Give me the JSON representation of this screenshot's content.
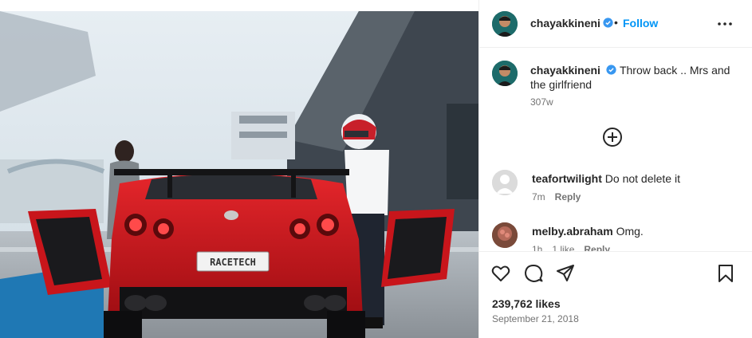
{
  "post": {
    "image_alt": "",
    "colors": {
      "accent": "#0095f6",
      "verified": "#3897f0",
      "car_red": "#d11a1f"
    },
    "plate_text": "RACETECH"
  },
  "header": {
    "username": "chayakkineni",
    "separator": "•",
    "follow_label": "Follow",
    "more_icon": "more-horizontal-icon"
  },
  "caption": {
    "username": "chayakkineni",
    "text": "Throw back .. Mrs and the girlfriend",
    "time": "307w"
  },
  "add_comment_icon": "plus-circle-icon",
  "comments": [
    {
      "username": "teafortwilight",
      "text": "Do not delete it",
      "time": "7m",
      "likes": "",
      "reply": "Reply"
    },
    {
      "username": "melby.abraham",
      "text": "Omg.",
      "time": "1h",
      "likes": "1 like",
      "reply": "Reply"
    }
  ],
  "actions": {
    "icons": [
      "heart-icon",
      "comment-icon",
      "share-icon",
      "bookmark-icon"
    ],
    "likes": "239,762 likes",
    "date": "September 21, 2018"
  }
}
